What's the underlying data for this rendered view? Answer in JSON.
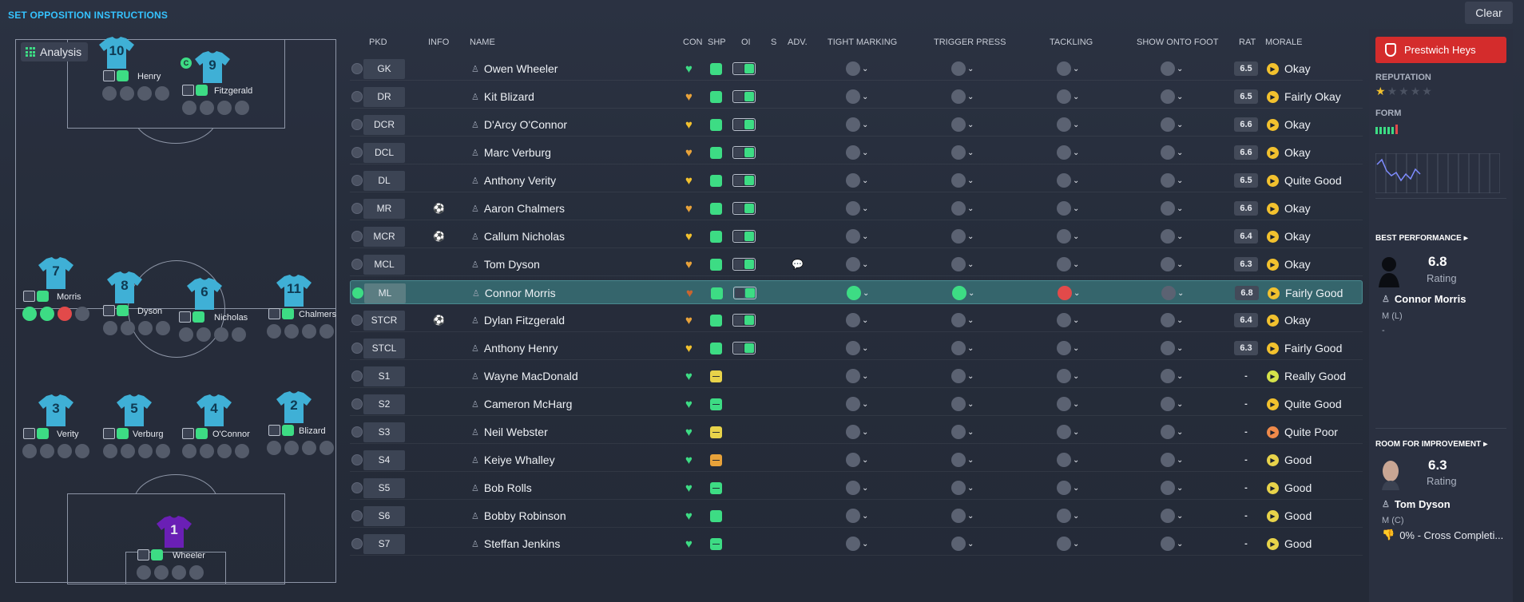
{
  "header": {
    "title": "SET OPPOSITION INSTRUCTIONS",
    "clear_label": "Clear"
  },
  "pitch": {
    "analysis_label": "Analysis",
    "players": [
      {
        "number": "10",
        "name": "Henry"
      },
      {
        "number": "9",
        "name": "Fitzgerald",
        "captain": "C"
      },
      {
        "number": "7",
        "name": "Morris"
      },
      {
        "number": "8",
        "name": "Dyson"
      },
      {
        "number": "6",
        "name": "Nicholas"
      },
      {
        "number": "11",
        "name": "Chalmers"
      },
      {
        "number": "3",
        "name": "Verity"
      },
      {
        "number": "5",
        "name": "Verburg"
      },
      {
        "number": "4",
        "name": "O'Connor"
      },
      {
        "number": "2",
        "name": "Blizard"
      },
      {
        "number": "1",
        "name": "Wheeler"
      }
    ]
  },
  "table": {
    "columns": [
      "PKD",
      "INFO",
      "NAME",
      "CON",
      "SHP",
      "OI",
      "S",
      "ADV.",
      "TIGHT MARKING",
      "TRIGGER PRESS",
      "TACKLING",
      "SHOW ONTO FOOT",
      "RAT",
      "MORALE"
    ],
    "rows": [
      {
        "pos": "GK",
        "name": "Owen Wheeler",
        "con": "green",
        "shp": "green",
        "oi": true,
        "rat": "6.5",
        "morale": "Okay"
      },
      {
        "pos": "DR",
        "name": "Kit Blizard",
        "con": "orange",
        "shp": "green",
        "oi": true,
        "rat": "6.5",
        "morale": "Fairly Okay"
      },
      {
        "pos": "DCR",
        "name": "D'Arcy O'Connor",
        "con": "yellow",
        "shp": "green",
        "oi": true,
        "rat": "6.6",
        "morale": "Okay"
      },
      {
        "pos": "DCL",
        "name": "Marc Verburg",
        "con": "orange",
        "shp": "green",
        "oi": true,
        "rat": "6.6",
        "morale": "Okay"
      },
      {
        "pos": "DL",
        "name": "Anthony Verity",
        "con": "yellow",
        "shp": "green",
        "oi": true,
        "rat": "6.5",
        "morale": "Quite Good"
      },
      {
        "pos": "MR",
        "name": "Aaron Chalmers",
        "con": "orange",
        "shp": "green",
        "oi": true,
        "rat": "6.6",
        "morale": "Okay",
        "info": "ball"
      },
      {
        "pos": "MCR",
        "name": "Callum Nicholas",
        "con": "yellow",
        "shp": "green",
        "oi": true,
        "rat": "6.4",
        "morale": "Okay",
        "info": "ball"
      },
      {
        "pos": "MCL",
        "name": "Tom Dyson",
        "con": "orange",
        "shp": "green",
        "oi": true,
        "rat": "6.3",
        "morale": "Okay",
        "adv": true
      },
      {
        "pos": "ML",
        "name": "Connor Morris",
        "con": "red",
        "shp": "green",
        "oi": true,
        "rat": "6.8",
        "morale": "Fairly Good",
        "selected": true
      },
      {
        "pos": "STCR",
        "name": "Dylan Fitzgerald",
        "con": "orange",
        "shp": "green",
        "oi": true,
        "rat": "6.4",
        "morale": "Okay",
        "info": "ball"
      },
      {
        "pos": "STCL",
        "name": "Anthony Henry",
        "con": "yellow",
        "shp": "green",
        "oi": true,
        "rat": "6.3",
        "morale": "Fairly Good"
      },
      {
        "pos": "S1",
        "name": "Wayne MacDonald",
        "con": "green",
        "shp": "yellow",
        "rat": "-",
        "morale": "Really Good"
      },
      {
        "pos": "S2",
        "name": "Cameron McHarg",
        "con": "green",
        "shp": "green-dash",
        "rat": "-",
        "morale": "Quite Good"
      },
      {
        "pos": "S3",
        "name": "Neil Webster",
        "con": "green",
        "shp": "yellow",
        "rat": "-",
        "morale": "Quite Poor"
      },
      {
        "pos": "S4",
        "name": "Keiye Whalley",
        "con": "green",
        "shp": "orange",
        "rat": "-",
        "morale": "Good"
      },
      {
        "pos": "S5",
        "name": "Bob Rolls",
        "con": "green",
        "shp": "green-dash",
        "rat": "-",
        "morale": "Good"
      },
      {
        "pos": "S6",
        "name": "Bobby Robinson",
        "con": "green",
        "shp": "green",
        "rat": "-",
        "morale": "Good"
      },
      {
        "pos": "S7",
        "name": "Steffan Jenkins",
        "con": "green",
        "shp": "green-dash",
        "rat": "-",
        "morale": "Good"
      }
    ]
  },
  "panel": {
    "club_name": "Prestwich Heys",
    "reputation_label": "REPUTATION",
    "form_label": "FORM",
    "best_performance": {
      "title": "BEST PERFORMANCE",
      "rating": "6.8",
      "rating_label": "Rating",
      "player": "Connor Morris",
      "position": "M (L)",
      "note": "-"
    },
    "room_for_improvement": {
      "title": "ROOM FOR IMPROVEMENT",
      "rating": "6.3",
      "rating_label": "Rating",
      "player": "Tom Dyson",
      "position": "M (C)",
      "note": "0% - Cross Completi..."
    }
  },
  "colors": {
    "accent": "#35c3ff",
    "green": "#3ddc84",
    "club_red": "#d42c2c",
    "selected_row": "#35656c",
    "kit": "#3fb0d6",
    "gk_kit": "#6a1fb5"
  }
}
